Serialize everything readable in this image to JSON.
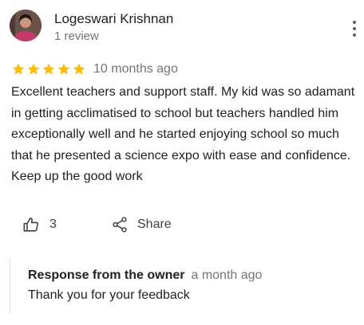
{
  "review": {
    "reviewer_name": "Logeswari Krishnan",
    "review_count": "1 review",
    "rating": 5,
    "rating_max": 5,
    "time": "10 months ago",
    "text": "Excellent teachers and support staff. My kid was so adamant in getting acclimatised to school but teachers handled him exceptionally well and he started enjoying school so much that he presented a science expo with ease and confidence. Keep up the good work"
  },
  "actions": {
    "like_count": "3",
    "share_label": "Share"
  },
  "owner_response": {
    "title": "Response from the owner",
    "time": "a month ago",
    "text": "Thank you for your feedback"
  },
  "colors": {
    "star": "#fbbc04",
    "secondary_text": "#70757a",
    "primary_text": "#202124",
    "icon": "#5f6368"
  },
  "icons": {
    "like": "thumb-up-outline-icon",
    "share": "share-icon",
    "more": "more-vert-icon",
    "star": "star-icon"
  }
}
